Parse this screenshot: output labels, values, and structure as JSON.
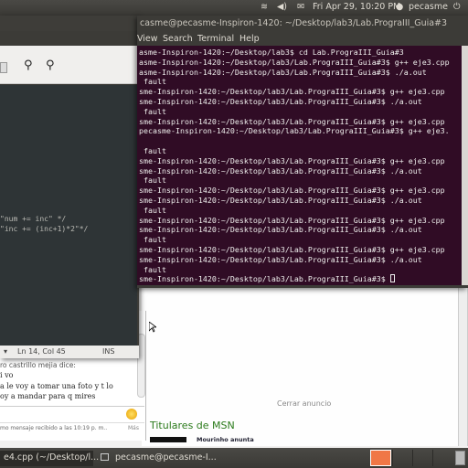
{
  "top_panel": {
    "datetime": "Fri Apr 29, 10:20 PM",
    "user": "pecasme",
    "icons": [
      "wifi-icon",
      "volume-icon",
      "mail-icon",
      "user-icon",
      "power-icon"
    ]
  },
  "terminal": {
    "title": "casme@pecasme-Inspiron-1420: ~/Desktop/lab3/Lab.PrograIII_Guia#3",
    "menu": [
      "View",
      "Search",
      "Terminal",
      "Help"
    ],
    "lines": [
      "asme-Inspiron-1420:~/Desktop/lab3$ cd Lab.PrograIII_Guia#3",
      "asme-Inspiron-1420:~/Desktop/lab3/Lab.PrograIII_Guia#3$ g++ eje3.cpp",
      "asme-Inspiron-1420:~/Desktop/lab3/Lab.PrograIII_Guia#3$ ./a.out",
      " fault",
      "sme-Inspiron-1420:~/Desktop/lab3/Lab.PrograIII_Guia#3$ g++ eje3.cpp",
      "sme-Inspiron-1420:~/Desktop/lab3/Lab.PrograIII_Guia#3$ ./a.out",
      " fault",
      "sme-Inspiron-1420:~/Desktop/lab3/Lab.PrograIII_Guia#3$ g++ eje3.cpp",
      "pecasme-Inspiron-1420:~/Desktop/lab3/Lab.PrograIII_Guia#3$ g++ eje3.",
      "",
      " fault",
      "sme-Inspiron-1420:~/Desktop/lab3/Lab.PrograIII_Guia#3$ g++ eje3.cpp",
      "sme-Inspiron-1420:~/Desktop/lab3/Lab.PrograIII_Guia#3$ ./a.out",
      " fault",
      "sme-Inspiron-1420:~/Desktop/lab3/Lab.PrograIII_Guia#3$ g++ eje3.cpp",
      "sme-Inspiron-1420:~/Desktop/lab3/Lab.PrograIII_Guia#3$ ./a.out",
      " fault",
      "sme-Inspiron-1420:~/Desktop/lab3/Lab.PrograIII_Guia#3$ g++ eje3.cpp",
      "sme-Inspiron-1420:~/Desktop/lab3/Lab.PrograIII_Guia#3$ ./a.out",
      " fault",
      "sme-Inspiron-1420:~/Desktop/lab3/Lab.PrograIII_Guia#3$ g++ eje3.cpp",
      "sme-Inspiron-1420:~/Desktop/lab3/Lab.PrograIII_Guia#3$ ./a.out",
      " fault",
      "sme-Inspiron-1420:~/Desktop/lab3/Lab.PrograIII_Guia#3$ "
    ],
    "background": "#300a24"
  },
  "editor": {
    "code_lines": [
      "\"num += inc\" */",
      "\"inc += (inc+1)*2\"*/"
    ],
    "status_position": "Ln 14, Col 45",
    "status_mode": "INS",
    "background": "#2e3436"
  },
  "chat": {
    "sender": "ro castrillo mejia dice:",
    "messages": [
      "i vo",
      "a le voy a tomar una foto y t lo",
      "oy a mandar para q mires"
    ],
    "status": "mo mensaje recibido a las 10:19 p. m..",
    "more": "Más"
  },
  "browser": {
    "close_ad": "Cerrar anuncio",
    "section_title": "Titulares de MSN",
    "headline": "Mourinho anunta"
  },
  "taskbar": {
    "items": [
      "e4.cpp (~/Desktop/l...",
      "pecasme@pecasme-I..."
    ]
  }
}
